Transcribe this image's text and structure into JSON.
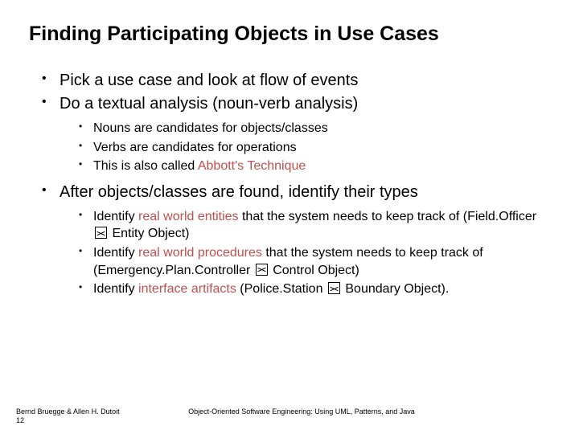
{
  "title": "Finding Participating Objects in Use Cases",
  "b1": "Pick a use case and look at flow of events",
  "b2": "Do a textual analysis (noun-verb analysis)",
  "s1": "Nouns are candidates for objects/classes",
  "s2": "Verbs are candidates for operations",
  "s3a": "This is also called ",
  "s3b": "Abbott's Technique",
  "b3": "After objects/classes are found, identify their types",
  "t1a": "Identify ",
  "t1b": "real world entities",
  "t1c": " that the system needs to keep track of (Field.Officer ",
  "t1d": " Entity Object)",
  "t2a": "Identify ",
  "t2b": "real world procedures",
  "t2c": " that the system needs to keep track of (Emergency.Plan.Controller ",
  "t2d": " Control Object)",
  "t3a": "Identify ",
  "t3b": "interface artifacts",
  "t3c": " (Police.Station ",
  "t3d": " Boundary Object).",
  "footer_left": "Bernd Bruegge & Allen H. Dutoit",
  "footer_num": "12",
  "footer_center": "Object-Oriented Software Engineering: Using UML, Patterns, and Java"
}
